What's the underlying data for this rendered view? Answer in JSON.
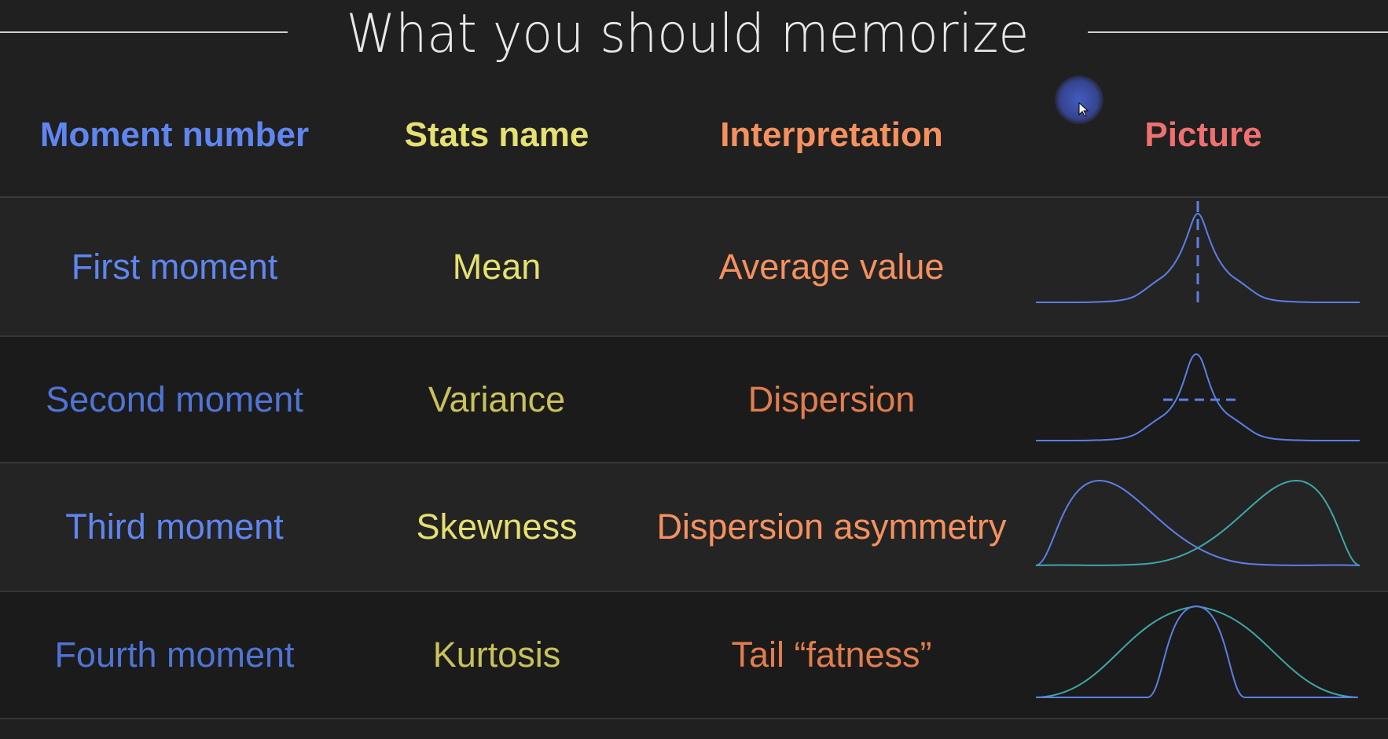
{
  "title": "What you should memorize",
  "table": {
    "headers": {
      "moment_number": "Moment number",
      "stats_name": "Stats name",
      "interpretation": "Interpretation",
      "picture": "Picture"
    },
    "rows": [
      {
        "moment": "First moment",
        "stat": "Mean",
        "interpretation": "Average value",
        "picture": "mean-line-icon"
      },
      {
        "moment": "Second moment",
        "stat": "Variance",
        "interpretation": "Dispersion",
        "picture": "variance-width-icon"
      },
      {
        "moment": "Third moment",
        "stat": "Skewness",
        "interpretation": "Dispersion asymmetry",
        "picture": "skewness-curves-icon"
      },
      {
        "moment": "Fourth moment",
        "stat": "Kurtosis",
        "interpretation": "Tail “fatness”",
        "picture": "kurtosis-curves-icon"
      }
    ]
  },
  "colors": {
    "background": "#202020",
    "moment_column": "#5f86f0",
    "stats_column": "#e6e070",
    "interpretation_column": "#f6915e",
    "picture_header": "#f07070",
    "curve_blue": "#5b7fe6",
    "curve_teal": "#3fa7a8"
  }
}
